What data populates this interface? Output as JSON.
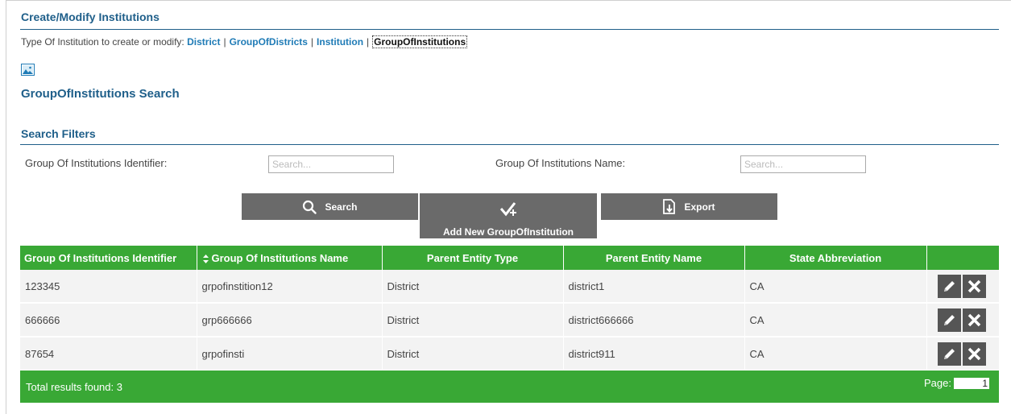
{
  "header": {
    "title": "Create/Modify Institutions"
  },
  "type_selector": {
    "prefix": "Type Of Institution to create or modify:",
    "links": [
      "District",
      "GroupOfDistricts",
      "Institution"
    ],
    "current": "GroupOfInstitutions",
    "separator": "|"
  },
  "search_title": "GroupOfInstitutions Search",
  "filters": {
    "title": "Search Filters",
    "identifier_label": "Group Of Institutions Identifier:",
    "identifier_placeholder": "Search...",
    "name_label": "Group Of Institutions Name:",
    "name_placeholder": "Search..."
  },
  "buttons": {
    "search": "Search",
    "add_new": "Add New GroupOfInstitution",
    "export": "Export"
  },
  "table": {
    "columns": [
      "Group Of Institutions Identifier",
      "Group Of Institutions Name",
      "Parent Entity Type",
      "Parent Entity Name",
      "State Abbreviation",
      ""
    ],
    "rows": [
      [
        "123345",
        "grpofinstition12",
        "District",
        "district1",
        "CA"
      ],
      [
        "666666",
        "grp666666",
        "District",
        "district666666",
        "CA"
      ],
      [
        "87654",
        "grpofinsti",
        "District",
        "district911",
        "CA"
      ]
    ]
  },
  "footer": {
    "total": "Total results found: 3",
    "page_label": "Page:",
    "page_value": "1"
  },
  "colors": {
    "heading": "#1f5f8a",
    "link": "#1f7bb6",
    "grid_green": "#39a835",
    "button_gray": "#6a6a6a"
  },
  "icons": {
    "image": "broken-image-icon",
    "search": "magnifier-icon",
    "add": "check-plus-icon",
    "export": "export-file-icon",
    "sort": "sort-icon",
    "edit": "pencil-icon",
    "delete": "x-icon"
  }
}
